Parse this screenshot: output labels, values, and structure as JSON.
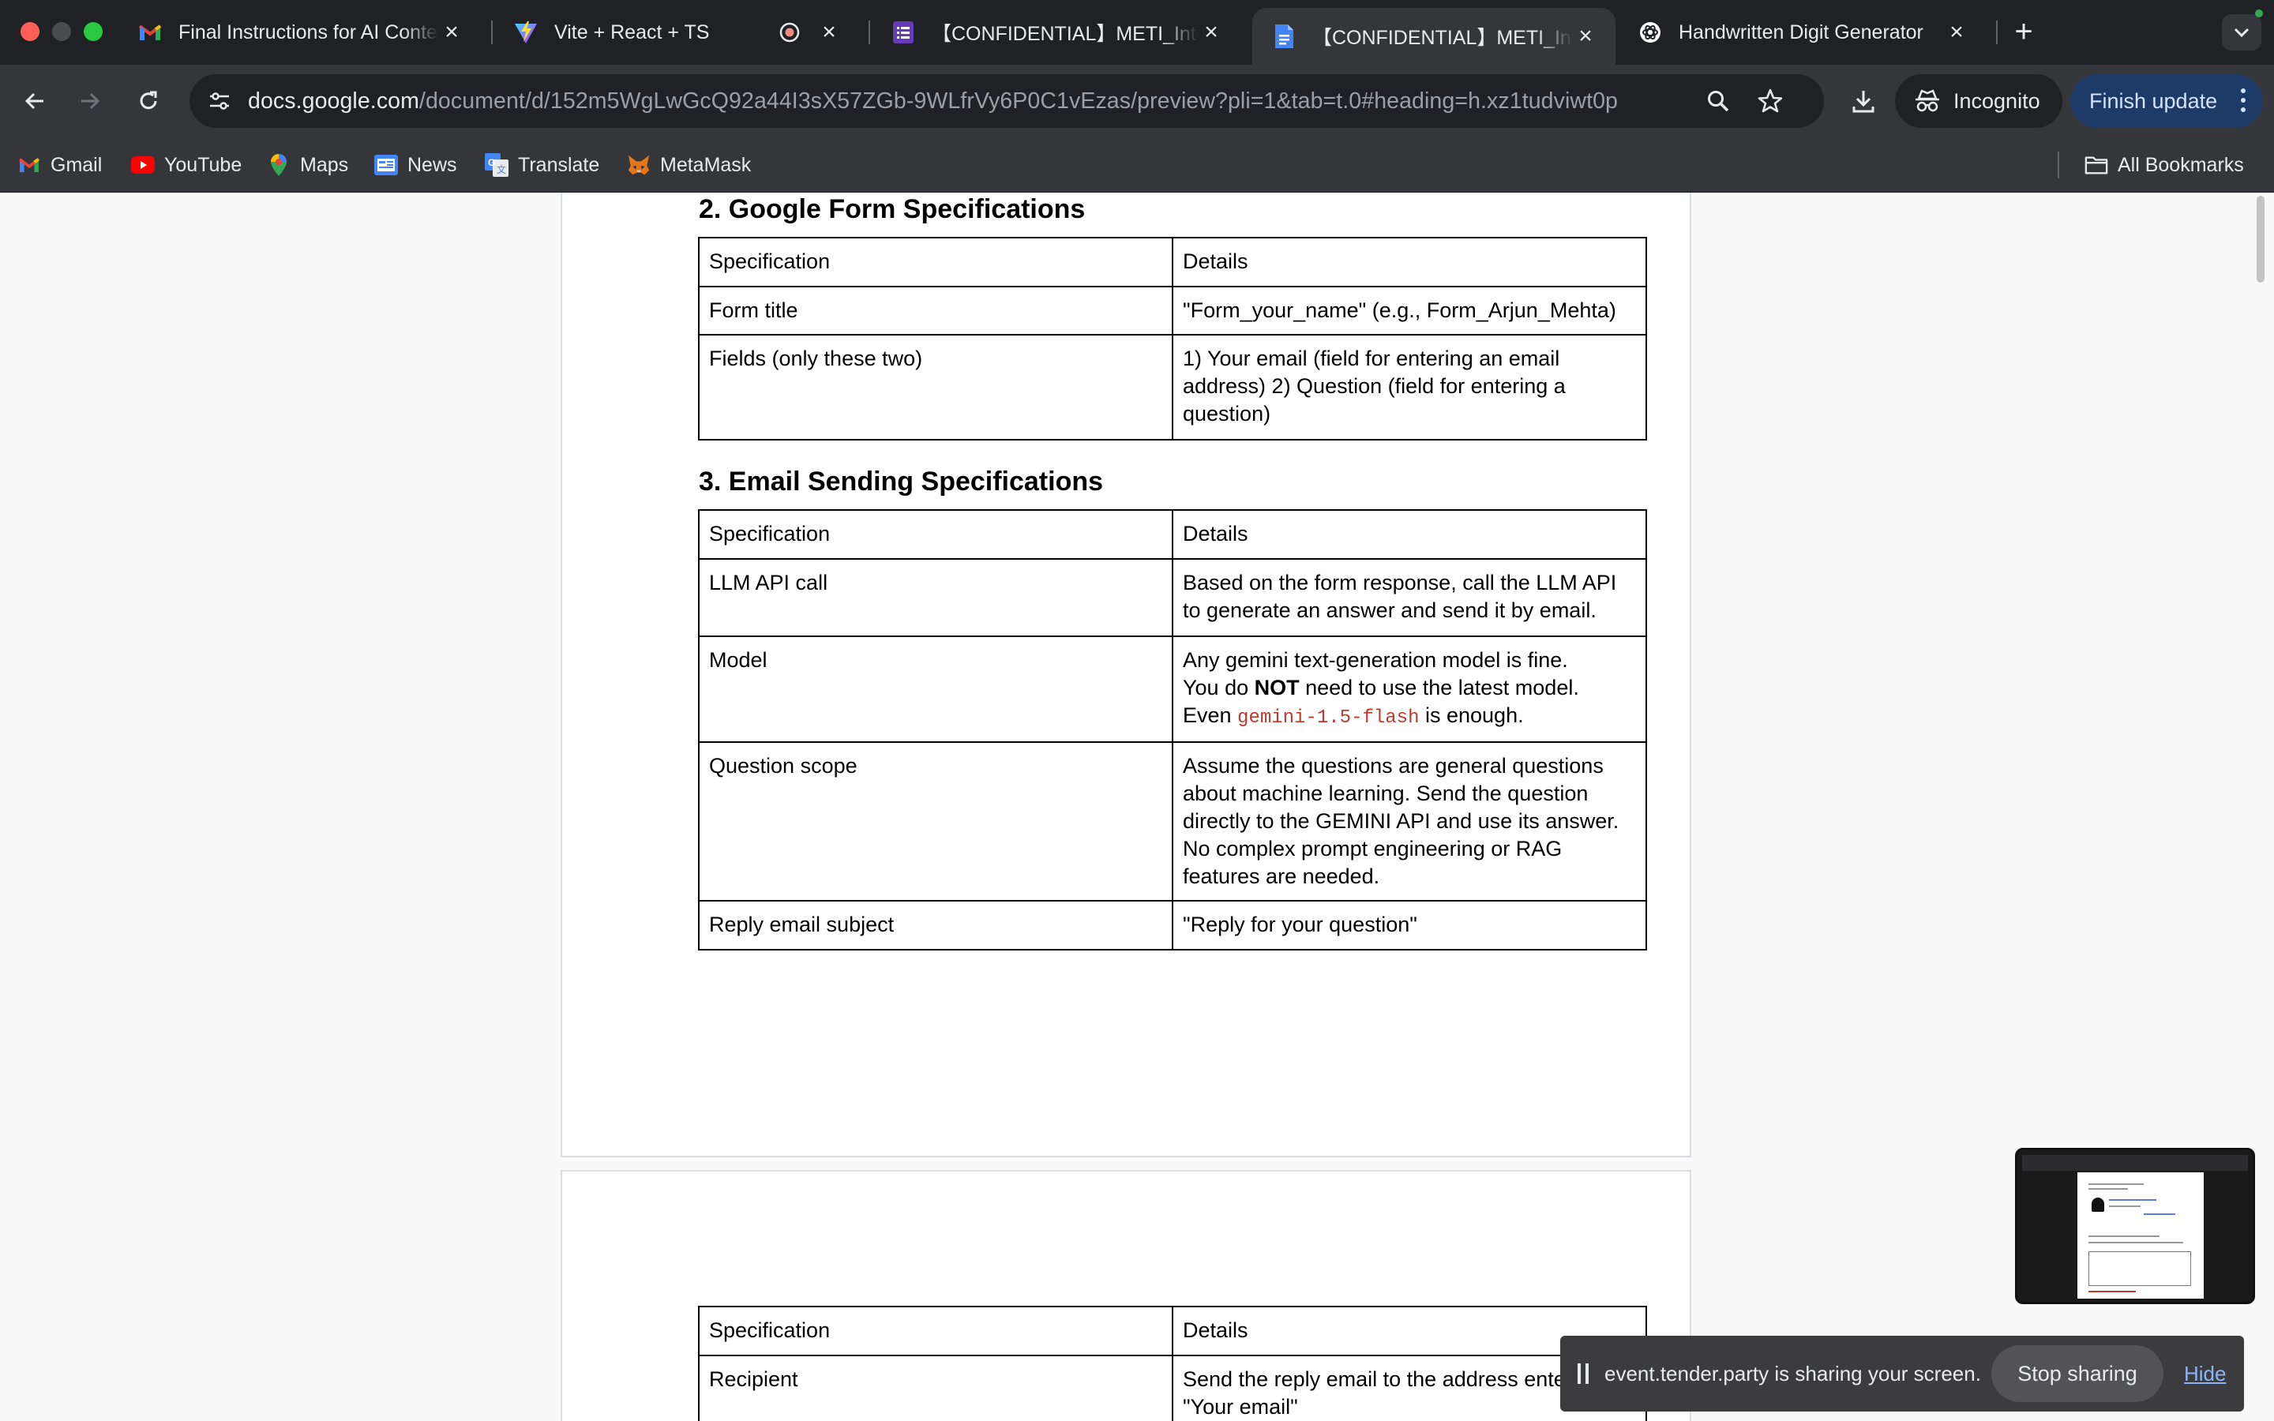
{
  "tabs": [
    {
      "title": "Final Instructions for AI Content",
      "favicon": "gmail-icon"
    },
    {
      "title": "Vite + React + TS",
      "favicon": "vite-icon"
    },
    {
      "title": "【CONFIDENTIAL】METI_Intern",
      "favicon": "forms-icon"
    },
    {
      "title": "【CONFIDENTIAL】METI_Intern",
      "favicon": "docs-icon",
      "active": true
    },
    {
      "title": "Handwritten Digit Generator",
      "favicon": "openai-icon"
    }
  ],
  "toolbar": {
    "url_host": "docs.google.com",
    "url_path": "/document/d/152m5WgLwGcQ92a44I3sX57ZGb-9WLfrVy6P0C1vEzas/preview?pli=1&tab=t.0#heading=h.xz1tudviwt0p",
    "incognito_label": "Incognito",
    "finish_update_label": "Finish update"
  },
  "bookmarks": [
    {
      "label": "Gmail",
      "icon": "gmail-icon"
    },
    {
      "label": "YouTube",
      "icon": "youtube-icon"
    },
    {
      "label": "Maps",
      "icon": "maps-icon"
    },
    {
      "label": "News",
      "icon": "news-icon"
    },
    {
      "label": "Translate",
      "icon": "translate-icon"
    },
    {
      "label": "MetaMask",
      "icon": "metamask-icon"
    }
  ],
  "all_bookmarks_label": "All Bookmarks",
  "doc": {
    "section2": {
      "heading": "2. Google Form Specifications",
      "header": [
        "Specification",
        "Details"
      ],
      "rows": [
        {
          "spec": "Form title",
          "details": "\"Form_your_name\" (e.g., Form_Arjun_Mehta)"
        },
        {
          "spec": "Fields (only these two)",
          "details": "1) Your email (field for entering an email address)  2) Question (field for entering a question)"
        }
      ]
    },
    "section3": {
      "heading": "3. Email Sending Specifications",
      "header": [
        "Specification",
        "Details"
      ],
      "rows": {
        "llm": {
          "spec": "LLM API call",
          "details": "Based on the form response, call the LLM API to generate an answer and send it by email."
        },
        "model": {
          "spec": "Model",
          "line1": "Any gemini text-generation model is fine.",
          "line2_pre": "You do ",
          "line2_bold": "NOT",
          "line2_post": " need to use the latest model.",
          "line3_pre": "Even ",
          "line3_code": "gemini-1.5-flash",
          "line3_post": " is enough."
        },
        "scope": {
          "spec": "Question scope",
          "details": "Assume the questions are general questions about machine learning. Send the question directly to the GEMINI API and use its answer. No complex prompt engineering or RAG features are needed."
        },
        "subject": {
          "spec": "Reply email subject",
          "details": "\"Reply for your question\""
        }
      }
    },
    "page2_table": {
      "header": [
        "Specification",
        "Details"
      ],
      "rows": [
        {
          "spec": "Recipient",
          "details": "Send the reply email to the address entered in \"Your email\""
        }
      ]
    }
  },
  "share_bar": {
    "message": "event.tender.party is sharing your screen.",
    "stop_label": "Stop sharing",
    "hide_label": "Hide"
  }
}
